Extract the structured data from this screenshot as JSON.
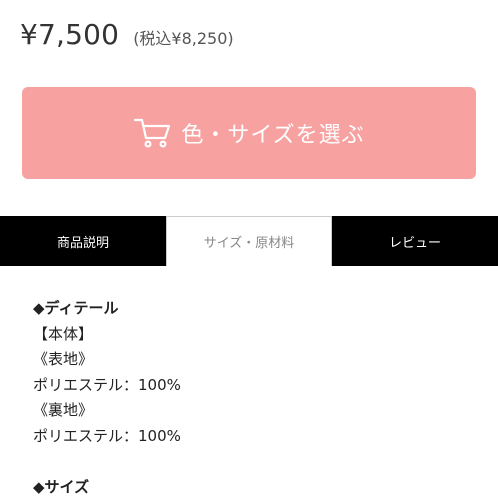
{
  "price": {
    "main": "¥7,500",
    "tax_included": "(税込¥8,250)"
  },
  "cart_button": {
    "label": "色・サイズを選ぶ",
    "icon": "cart-icon",
    "color": "#f7a1a1"
  },
  "tabs": [
    {
      "label": "商品説明",
      "active": false
    },
    {
      "label": "サイズ・原材料",
      "active": true
    },
    {
      "label": "レビュー",
      "active": false
    }
  ],
  "details": {
    "heading": "◆ディテール",
    "lines": [
      "【本体】",
      "《表地》",
      "ポリエステル：100%",
      "《裏地》",
      "ポリエステル：100%"
    ],
    "size_heading": "◆サイズ"
  }
}
